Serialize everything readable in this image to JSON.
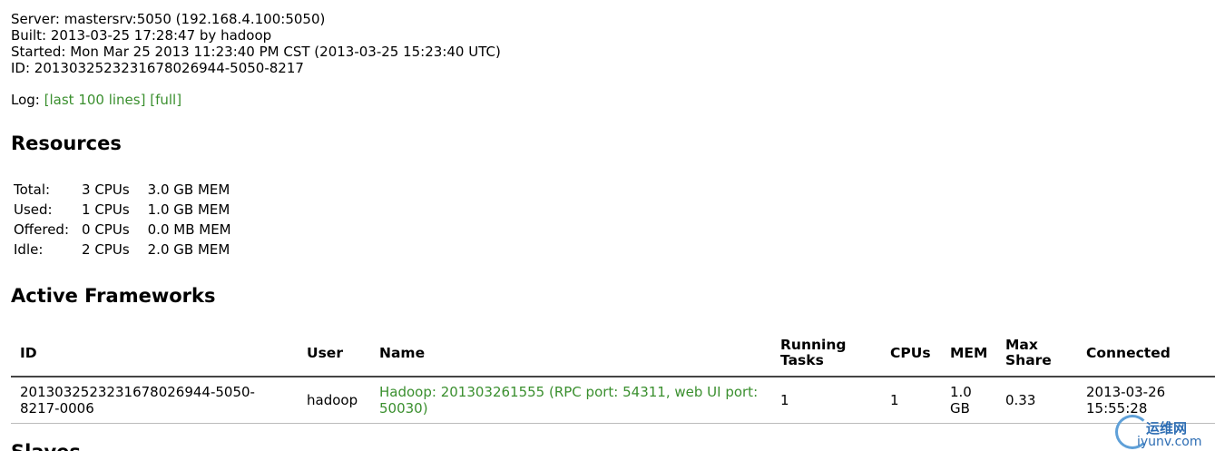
{
  "info": {
    "server": "Server: mastersrv:5050 (192.168.4.100:5050)",
    "built": "Built: 2013-03-25 17:28:47 by hadoop",
    "started": "Started: Mon Mar 25 2013 11:23:40 PM CST (2013-03-25 15:23:40 UTC)",
    "id": "ID: 201303252323167802694​4-5050-8217"
  },
  "log": {
    "label": "Log:",
    "last_100": "[last 100 lines]",
    "full": "[full]"
  },
  "resources": {
    "heading": "Resources",
    "rows": [
      {
        "label": "Total:",
        "cpus": "3 CPUs",
        "mem": "3.0 GB MEM"
      },
      {
        "label": "Used:",
        "cpus": "1 CPUs",
        "mem": "1.0 GB MEM"
      },
      {
        "label": "Offered:",
        "cpus": "0 CPUs",
        "mem": "0.0 MB MEM"
      },
      {
        "label": "Idle:",
        "cpus": "2 CPUs",
        "mem": "2.0 GB MEM"
      }
    ]
  },
  "frameworks": {
    "heading": "Active Frameworks",
    "columns": {
      "id": "ID",
      "user": "User",
      "name": "Name",
      "running_tasks": "Running Tasks",
      "cpus": "CPUs",
      "mem": "MEM",
      "max_share": "Max Share",
      "connected": "Connected"
    },
    "rows": [
      {
        "id": "201303252323167802694​4-5050-8217-0006",
        "user": "hadoop",
        "name": "Hadoop: 201303261555 (RPC port: 54311, web UI port: 50030)",
        "running_tasks": "1",
        "cpus": "1",
        "mem": "1.0 GB",
        "max_share": "0.33",
        "connected": "2013-03-26 15:55:28"
      }
    ]
  },
  "next_heading": "Slaves",
  "watermark": {
    "top": "运维网",
    "bottom": "iyunv.com"
  },
  "colors": {
    "link": "#3a8f2e",
    "watermark": "#2d6db3"
  }
}
